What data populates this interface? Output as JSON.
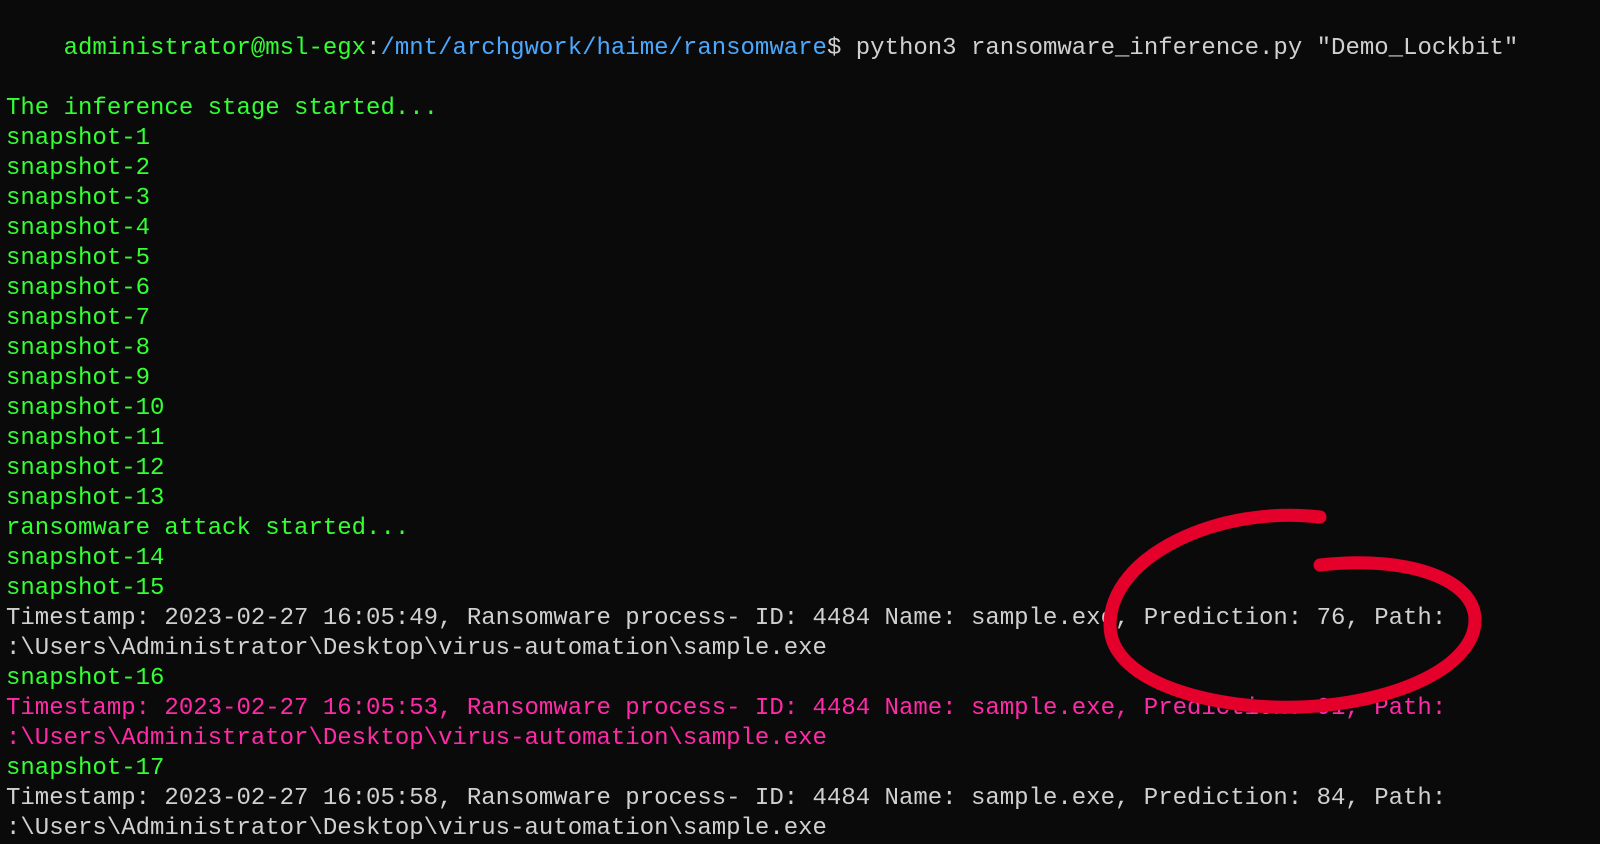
{
  "prompt": {
    "user_host": "administrator@msl-egx",
    "sep1": ":",
    "cwd": "/mnt/archgwork/haime/ransomware",
    "dollar": "$",
    "command": "python3 ransomware_inference.py \"Demo_Lockbit\""
  },
  "output": {
    "inference_started": "The inference stage started...",
    "snapshots_a": [
      "snapshot-1",
      "snapshot-2",
      "snapshot-3",
      "snapshot-4",
      "snapshot-5",
      "snapshot-6",
      "snapshot-7",
      "snapshot-8",
      "snapshot-9",
      "snapshot-10",
      "snapshot-11",
      "snapshot-12",
      "snapshot-13"
    ],
    "attack_started": "ransomware attack started...",
    "snapshots_b": [
      "snapshot-14",
      "snapshot-15"
    ],
    "detect_0_a": "Timestamp: 2023-02-27 16:05:49, Ransomware process- ID: 4484 Name: sample.exe, Prediction: 76, Path:",
    "detect_0_b": ":\\Users\\Administrator\\Desktop\\virus-automation\\sample.exe",
    "snapshots_c": [
      "snapshot-16"
    ],
    "detect_1_a": "Timestamp: 2023-02-27 16:05:53, Ransomware process- ID: 4484 Name: sample.exe, Prediction: 91, Path:",
    "detect_1_b": ":\\Users\\Administrator\\Desktop\\virus-automation\\sample.exe",
    "snapshots_d": [
      "snapshot-17"
    ],
    "detect_2_a": "Timestamp: 2023-02-27 16:05:58, Ransomware process- ID: 4484 Name: sample.exe, Prediction: 84, Path:",
    "detect_2_b": ":\\Users\\Administrator\\Desktop\\virus-automation\\sample.exe"
  },
  "annotation": {
    "color": "#e4002b",
    "name": "circle-highlight"
  }
}
